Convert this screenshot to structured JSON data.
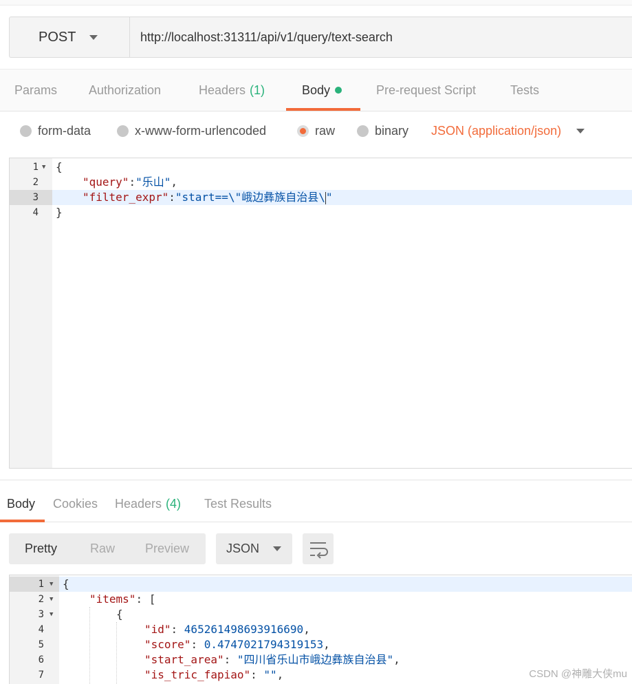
{
  "request": {
    "method": "POST",
    "url": "http://localhost:31311/api/v1/query/text-search"
  },
  "request_tabs": [
    {
      "label": "Params"
    },
    {
      "label": "Authorization"
    },
    {
      "label": "Headers",
      "count": "(1)"
    },
    {
      "label": "Body"
    },
    {
      "label": "Pre-request Script"
    },
    {
      "label": "Tests"
    }
  ],
  "body_types": {
    "options": [
      "form-data",
      "x-www-form-urlencoded",
      "raw",
      "binary"
    ],
    "selected": "raw",
    "content_type": "JSON (application/json)"
  },
  "request_body_lines": [
    {
      "n": "1",
      "text": "{"
    },
    {
      "n": "2",
      "key": "\"query\"",
      "sep": ":",
      "val": "\"乐山\"",
      "tail": ","
    },
    {
      "n": "3",
      "key": "\"filter_expr\"",
      "sep": ":",
      "val": "\"start==\\\"峨边彝族自治县\\",
      "tail": "\""
    },
    {
      "n": "4",
      "text": "}"
    }
  ],
  "response_tabs": [
    {
      "label": "Body"
    },
    {
      "label": "Cookies"
    },
    {
      "label": "Headers",
      "count": "(4)"
    },
    {
      "label": "Test Results"
    }
  ],
  "response_view": {
    "modes": [
      "Pretty",
      "Raw",
      "Preview"
    ],
    "active_mode": "Pretty",
    "format": "JSON"
  },
  "response_body_lines": [
    {
      "n": "1",
      "text": "{"
    },
    {
      "n": "2",
      "key": "\"items\"",
      "sep": ": ",
      "text": "["
    },
    {
      "n": "3",
      "text": "{"
    },
    {
      "n": "4",
      "key": "\"id\"",
      "sep": ": ",
      "num": "465261498693916690",
      "tail": ","
    },
    {
      "n": "5",
      "key": "\"score\"",
      "sep": ": ",
      "num": "0.4747021794319153",
      "tail": ","
    },
    {
      "n": "6",
      "key": "\"start_area\"",
      "sep": ": ",
      "val": "\"四川省乐山市峨边彝族自治县\"",
      "tail": ","
    },
    {
      "n": "7",
      "key": "\"is_tric_fapiao\"",
      "sep": ": ",
      "val": "\"\"",
      "tail": ","
    }
  ],
  "watermark": "CSDN @神雕大侠mu",
  "colors": {
    "accent": "#f26b3a",
    "success": "#2ab27b",
    "json_key": "#a31515",
    "json_string": "#0451a5",
    "json_number": "#098658"
  }
}
